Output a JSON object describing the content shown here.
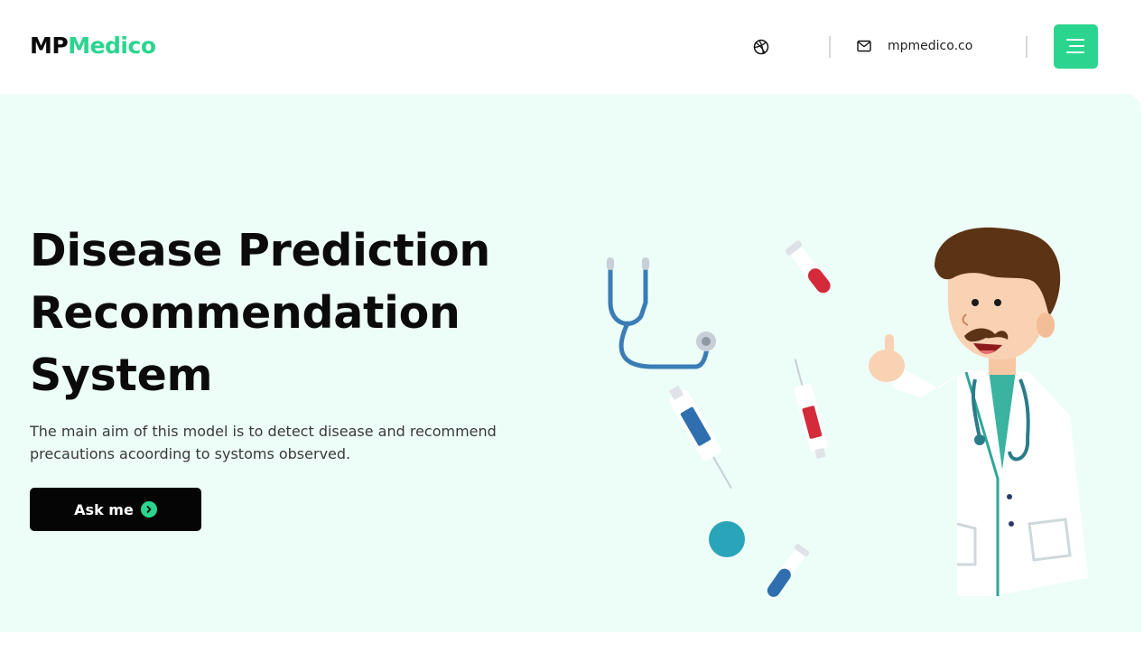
{
  "header": {
    "logo_part1": "MP",
    "logo_part2": "Medico",
    "email": "mpmedico.co",
    "icons": {
      "dribbble": "dribbble-icon",
      "mail": "mail-icon",
      "menu": "menu-icon"
    }
  },
  "hero": {
    "title_line1": "Disease Prediction",
    "title_line2": "Recommendation",
    "title_line3": "System",
    "description": "The main aim of this model is to detect disease and recommend precautions acoording to systoms observed.",
    "button_label": "Ask me"
  },
  "colors": {
    "brand_green": "#2bd58f",
    "hero_bg": "#edfdf8",
    "button_bg": "#050505"
  }
}
